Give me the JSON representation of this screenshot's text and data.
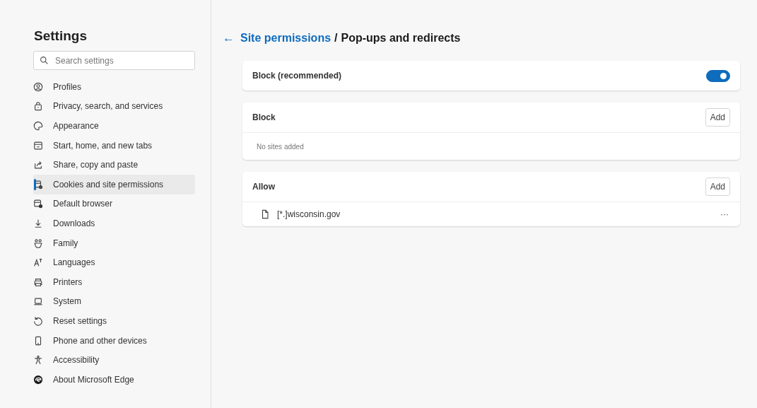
{
  "sidebar": {
    "title": "Settings",
    "search": {
      "placeholder": "Search settings"
    },
    "items": [
      {
        "label": "Profiles",
        "selected": false
      },
      {
        "label": "Privacy, search, and services",
        "selected": false
      },
      {
        "label": "Appearance",
        "selected": false
      },
      {
        "label": "Start, home, and new tabs",
        "selected": false
      },
      {
        "label": "Share, copy and paste",
        "selected": false
      },
      {
        "label": "Cookies and site permissions",
        "selected": true
      },
      {
        "label": "Default browser",
        "selected": false
      },
      {
        "label": "Downloads",
        "selected": false
      },
      {
        "label": "Family",
        "selected": false
      },
      {
        "label": "Languages",
        "selected": false
      },
      {
        "label": "Printers",
        "selected": false
      },
      {
        "label": "System",
        "selected": false
      },
      {
        "label": "Reset settings",
        "selected": false
      },
      {
        "label": "Phone and other devices",
        "selected": false
      },
      {
        "label": "Accessibility",
        "selected": false
      },
      {
        "label": "About Microsoft Edge",
        "selected": false
      }
    ]
  },
  "header": {
    "back": "←",
    "link": "Site permissions",
    "separator": "/",
    "title": "Pop-ups and redirects"
  },
  "toggle_card": {
    "label": "Block (recommended)",
    "on": true
  },
  "lists": [
    {
      "title": "Block",
      "button": "Add",
      "empty": "No sites added"
    },
    {
      "title": "Allow",
      "button": "Add",
      "sites": [
        {
          "name": "[*.]wisconsin.gov",
          "more": "···"
        }
      ]
    }
  ]
}
